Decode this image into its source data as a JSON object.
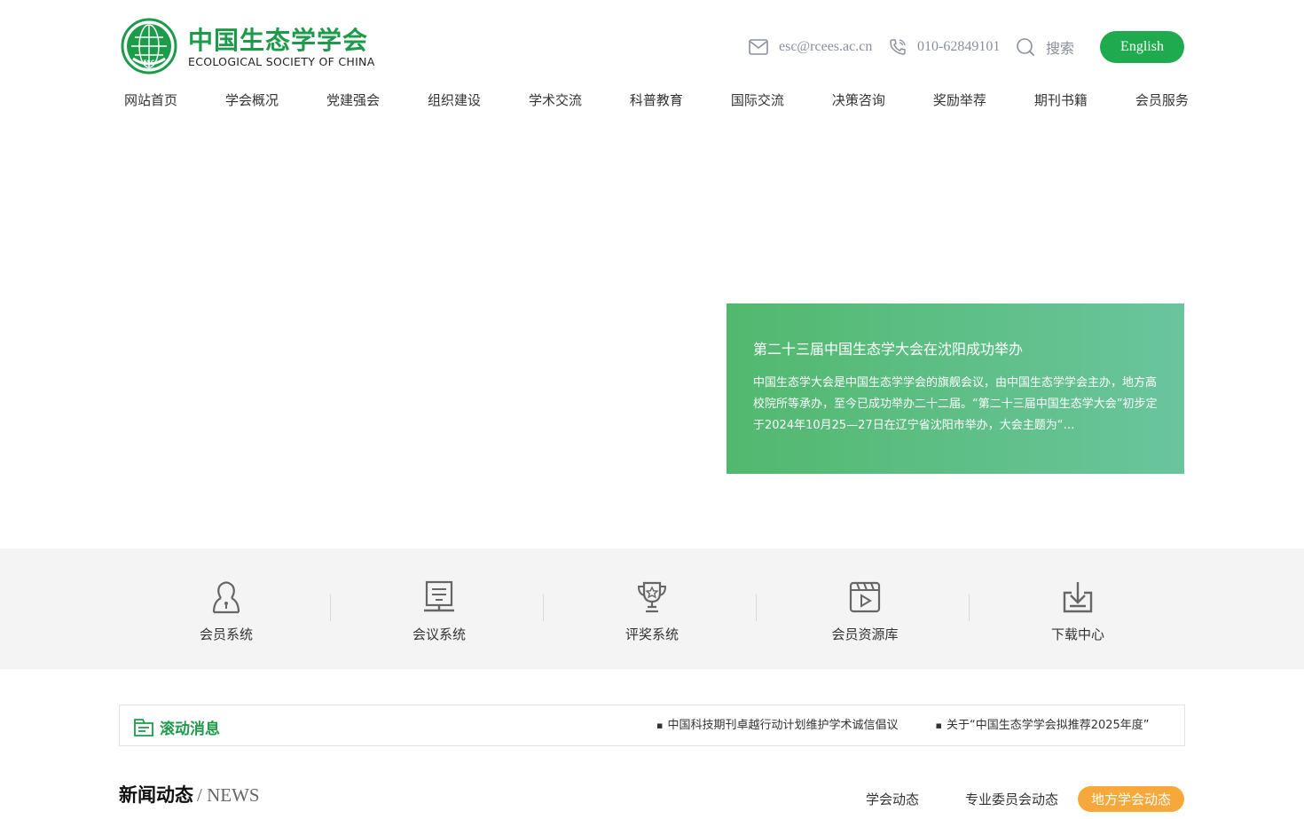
{
  "header": {
    "logo_cn": "中国生态学学会",
    "logo_en": "ECOLOGICAL SOCIETY OF CHINA",
    "logo_badge": "ESC",
    "email": "esc@rcees.ac.cn",
    "phone": "010-62849101",
    "search_label": "搜索",
    "english_label": "English",
    "brand_color": "#1faa4d"
  },
  "nav": {
    "items": [
      "网站首页",
      "学会概况",
      "党建强会",
      "组织建设",
      "学术交流",
      "科普教育",
      "国际交流",
      "决策咨询",
      "奖励举荐",
      "期刊书籍",
      "会员服务"
    ]
  },
  "banner": {
    "title": "第二十三届中国生态学大会在沈阳成功举办",
    "text": "中国生态学大会是中国生态学学会的旗舰会议，由中国生态学学会主办，地方高校院所等承办，至今已成功举办二十二届。“第二十三届中国生态学大会”初步定于2024年10月25—27日在辽宁省沈阳市举办，大会主题为“…"
  },
  "systems": {
    "items": [
      {
        "label": "会员系统",
        "icon": "user-icon"
      },
      {
        "label": "会议系统",
        "icon": "presentation-icon"
      },
      {
        "label": "评奖系统",
        "icon": "trophy-icon"
      },
      {
        "label": "会员资源库",
        "icon": "video-icon"
      },
      {
        "label": "下载中心",
        "icon": "download-icon"
      }
    ]
  },
  "ticker": {
    "title": "滚动消息",
    "items": [
      "中国科技期刊卓越行动计划维护学术诚信倡议",
      "关于“中国生态学学会拟推荐2025年度”"
    ]
  },
  "news": {
    "title_cn": "新闻动态",
    "title_en": "/ NEWS",
    "tabs": [
      "学会动态",
      "专业委员会动态",
      "地方学会动态"
    ],
    "active_tab": "地方学会动态",
    "accent_color": "#f6a93a"
  }
}
